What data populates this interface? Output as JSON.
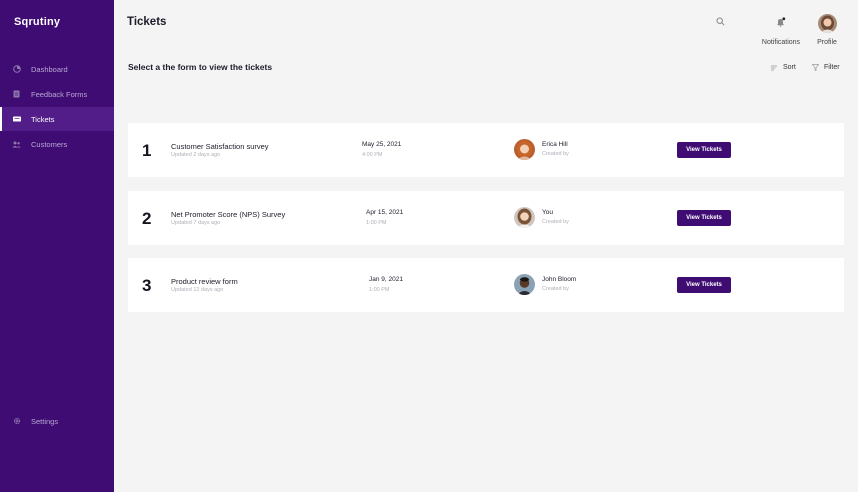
{
  "app": {
    "name": "Sqrutiny"
  },
  "sidebar": {
    "items": [
      {
        "label": "Dashboard",
        "icon": "dashboard-icon"
      },
      {
        "label": "Feedback Forms",
        "icon": "forms-icon"
      },
      {
        "label": "Tickets",
        "icon": "ticket-icon",
        "active": true
      },
      {
        "label": "Customers",
        "icon": "customers-icon"
      }
    ],
    "settings": {
      "label": "Settings",
      "icon": "gear-icon"
    }
  },
  "header": {
    "title": "Tickets",
    "notifications_label": "Notifications",
    "profile_label": "Profile"
  },
  "main": {
    "subtitle": "Select a the form to view the tickets",
    "sort_label": "Sort",
    "filter_label": "Filter",
    "forms": [
      {
        "number": "1",
        "title": "Customer Satisfaction survey",
        "updated": "Updated 2 days ago",
        "date": "May 25, 2021",
        "time": "4:00 PM",
        "owner": "Erica Hill",
        "created_by": "Created by",
        "button": "View Tickets"
      },
      {
        "number": "2",
        "title": "Net Promoter Score (NPS) Survey",
        "updated": "Updated 7 days ago",
        "date": "Apr 15, 2021",
        "time": "1:00 PM",
        "owner": "You",
        "created_by": "Created by",
        "button": "View Tickets"
      },
      {
        "number": "3",
        "title": "Product review form",
        "updated": "Updated 12 days ago",
        "date": "Jan 9, 2021",
        "time": "1:00 PM",
        "owner": "John Bloom",
        "created_by": "Created by",
        "button": "View Tickets"
      }
    ]
  },
  "colors": {
    "sidebar": "#3f0c73",
    "active_item": "#521c89",
    "button": "#3f0c73",
    "background": "#f4f4f4"
  }
}
